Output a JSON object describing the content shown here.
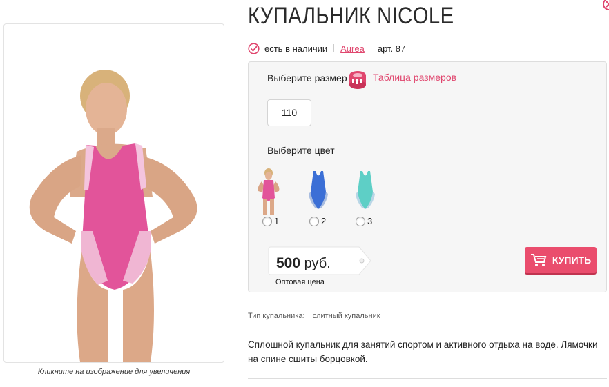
{
  "product": {
    "title": "КУПАЛЬНИК NICOLE",
    "stock": "есть в наличии",
    "brand": "Aurea",
    "article": "арт. 87",
    "image_caption": "Кликните на изображение для увеличения"
  },
  "size": {
    "label": "Выберите размер",
    "table_link": "Таблица размеров",
    "options": [
      "110"
    ]
  },
  "color": {
    "label": "Выберите цвет",
    "options": [
      {
        "number": "1",
        "color": "#e2549a"
      },
      {
        "number": "2",
        "color": "#3b6fd6"
      },
      {
        "number": "3",
        "color": "#5ecfc6"
      }
    ]
  },
  "price": {
    "amount": "500",
    "currency": "руб.",
    "note": "Оптовая цена"
  },
  "buy_button": "КУПИТЬ",
  "specs": {
    "type_label": "Тип купальника:",
    "type_value": "слитный купальник"
  },
  "description": "Сплошной купальник для занятий спортом и активного отдыха на воде. Лямочки на спине сшиты борцовкой.",
  "colors": {
    "accent": "#e0466e",
    "button": "#ea4d6d"
  }
}
